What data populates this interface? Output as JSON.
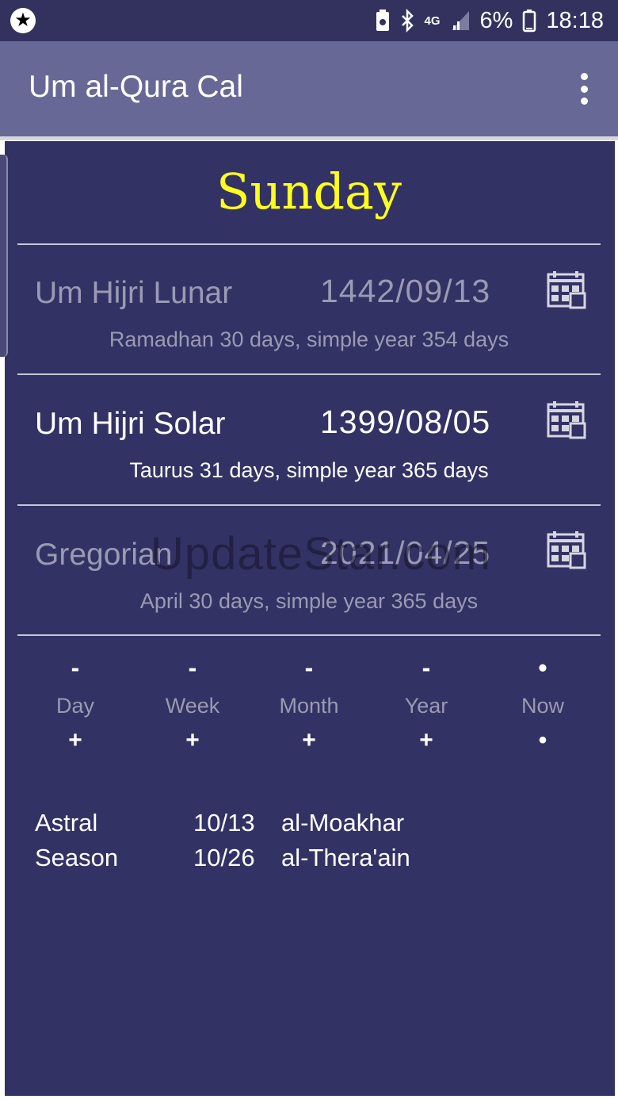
{
  "status_bar": {
    "battery_text": "6%",
    "time": "18:18",
    "network": "4G"
  },
  "app_bar": {
    "title": "Um al-Qura Cal",
    "menu_icon": "overflow-menu-icon"
  },
  "day_name": "Sunday",
  "calendars": [
    {
      "name": "Um Hijri Lunar",
      "date": "1442/09/13",
      "subtitle": "Ramadhan 30 days, simple year 354 days",
      "active": false
    },
    {
      "name": "Um Hijri Solar",
      "date": "1399/08/05",
      "subtitle": "Taurus 31 days, simple year 365 days",
      "active": true
    },
    {
      "name": "Gregorian",
      "date": "2021/04/25",
      "subtitle": "April 30 days, simple year 365 days",
      "active": false
    }
  ],
  "watermark": "UpdateStar.com",
  "steppers": [
    {
      "label": "Day",
      "minus": "-",
      "plus": "+"
    },
    {
      "label": "Week",
      "minus": "-",
      "plus": "+"
    },
    {
      "label": "Month",
      "minus": "-",
      "plus": "+"
    },
    {
      "label": "Year",
      "minus": "-",
      "plus": "+"
    },
    {
      "label": "Now",
      "minus": "•",
      "plus": "•"
    }
  ],
  "info": [
    {
      "label": "Astral",
      "date": "10/13",
      "name": "al-Moakhar"
    },
    {
      "label": "Season",
      "date": "10/26",
      "name": "al-Thera'ain"
    }
  ],
  "colors": {
    "background": "#333264",
    "app_bar": "#686896",
    "status_bar": "#33325f",
    "day_name": "#ffff1e",
    "dim_text": "#9a9ab4"
  }
}
